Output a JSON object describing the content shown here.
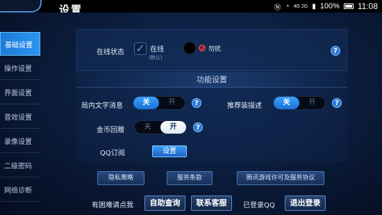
{
  "status_bar": {
    "network": "4G 2G",
    "battery": "100%",
    "time": "11:08"
  },
  "header": {
    "title": "设置"
  },
  "sidebar": {
    "items": [
      {
        "label": "基础设置",
        "active": true
      },
      {
        "label": "操作设置",
        "active": false
      },
      {
        "label": "界面设置",
        "active": false
      },
      {
        "label": "音效设置",
        "active": false
      },
      {
        "label": "录像设置",
        "active": false
      },
      {
        "label": "二级密码",
        "active": false
      },
      {
        "label": "网络诊断",
        "active": false
      }
    ]
  },
  "online_status": {
    "label": "在线状态",
    "online_label": "在线",
    "default_note": "(默认)",
    "dnd_label": "勿扰",
    "selected": "在线"
  },
  "func_section": {
    "title": "功能设置"
  },
  "settings": {
    "local_text": {
      "label": "局内文字消息",
      "off": "关",
      "on": "开",
      "state": "关"
    },
    "recommend": {
      "label": "推荐装描述",
      "off": "关",
      "on": "开",
      "state": "关"
    },
    "gold_gift": {
      "label": "金币回赠",
      "off": "关",
      "on": "开",
      "state": "开"
    },
    "qq_sub": {
      "label": "QQ订阅",
      "button": "设置"
    }
  },
  "links": {
    "privacy": "隐私策略",
    "terms": "服务条款",
    "license": "腾讯游戏许可及服务协议"
  },
  "footer": {
    "help_text": "有困难请点我",
    "self_query": "自助查询",
    "contact": "联系客服",
    "logged_in": "已登录QQ",
    "logout": "退出登录"
  }
}
